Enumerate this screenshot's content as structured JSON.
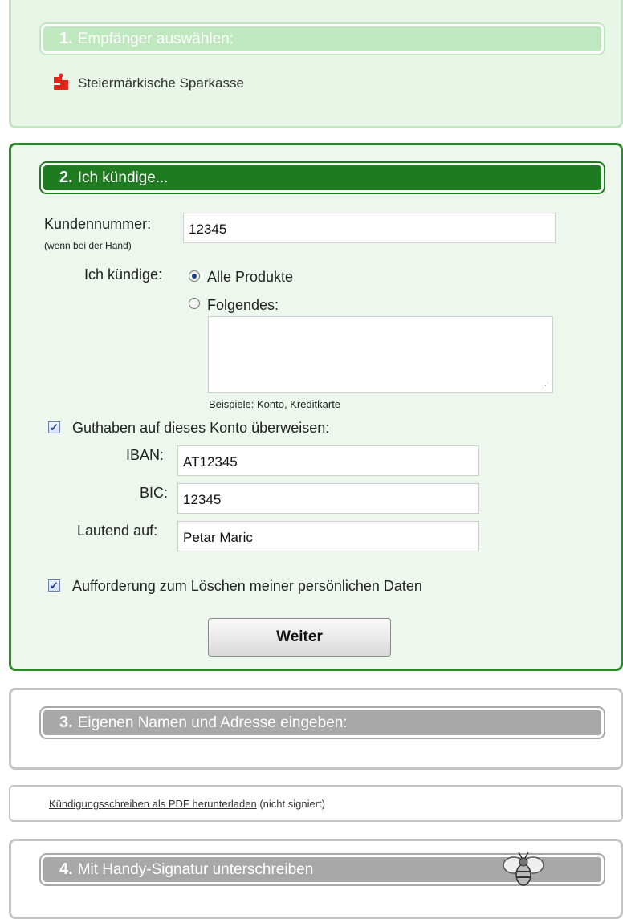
{
  "step1": {
    "number": "1.",
    "title": "Empfänger auswählen:",
    "bank_name": "Steiermärkische Sparkasse"
  },
  "step2": {
    "number": "2.",
    "title": "Ich kündige...",
    "kundennummer_label": "Kundennummer:",
    "kundennummer_hint": "(wenn bei der Hand)",
    "kundennummer_value": "12345",
    "ich_kuendige_label": "Ich kündige:",
    "option_all": "Alle Produkte",
    "option_following": "Folgendes:",
    "examples_hint": "Beispiele: Konto, Kreditkarte",
    "transfer_checkbox_label": "Guthaben auf dieses Konto überweisen:",
    "iban_label": "IBAN:",
    "iban_value": "AT12345",
    "bic_label": "BIC:",
    "bic_value": "12345",
    "holder_label": "Lautend auf:",
    "holder_value": "Petar Maric",
    "delete_checkbox_label": "Aufforderung zum Löschen meiner persönlichen Daten",
    "continue_button": "Weiter"
  },
  "step3": {
    "number": "3.",
    "title": "Eigenen Namen und Adresse eingeben:"
  },
  "pdf": {
    "link_text": "Kündigungsschreiben als PDF herunterladen",
    "note": "(nicht signiert)"
  },
  "step4": {
    "number": "4.",
    "title": "Mit Handy-Signatur unterschreiben"
  },
  "colors": {
    "active_green": "#1f7b1f",
    "inactive_gray": "#a8a8a8",
    "done_green": "#bfe8bf",
    "sparkasse_red": "#e2231a"
  }
}
